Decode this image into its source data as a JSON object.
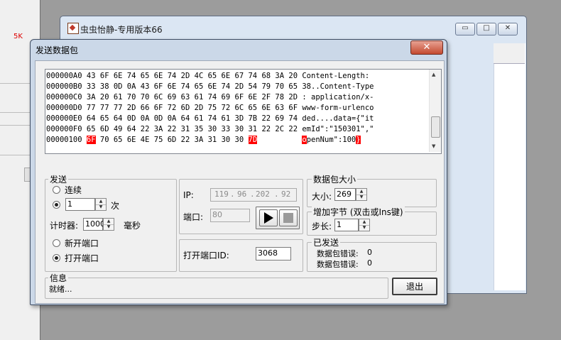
{
  "background_app": {
    "badge": "5K"
  },
  "main_window": {
    "title": "虫虫怡静-专用版本66",
    "minimize": "▭",
    "maximize": "□",
    "close": "✕"
  },
  "dialog": {
    "title": "发送数据包",
    "close": "✕"
  },
  "hex_view": {
    "rows": [
      {
        "addr": "000000A0",
        "bytes": "43 6F 6E 74 65 6E 74 2D 4C 65 6E 67 74 68 3A 20",
        "ascii": "Content-Length: "
      },
      {
        "addr": "000000B0",
        "bytes": "33 38 0D 0A 43 6F 6E 74 65 6E 74 2D 54 79 70 65",
        "ascii": "38..Content-Type"
      },
      {
        "addr": "000000C0",
        "bytes": "3A 20 61 70 70 6C 69 63 61 74 69 6F 6E 2F 78 2D",
        "ascii": ": application/x-"
      },
      {
        "addr": "000000D0",
        "bytes": "77 77 77 2D 66 6F 72 6D 2D 75 72 6C 65 6E 63 6F",
        "ascii": "www-form-urlenco"
      },
      {
        "addr": "000000E0",
        "bytes": "64 65 64 0D 0A 0D 0A 64 61 74 61 3D 7B 22 69 74",
        "ascii": "ded....data={\"it"
      },
      {
        "addr": "000000F0",
        "bytes": "65 6D 49 64 22 3A 22 31 35 30 33 30 31 22 2C 22",
        "ascii": "emId\":\"150301\",\""
      }
    ],
    "last_row": {
      "addr": "00000100",
      "first_byte": "6F",
      "mid_bytes": "70 65 6E 4E 75 6D 22 3A 31 30 30",
      "last_byte": "7D",
      "ascii_first": "o",
      "ascii_mid": "penNum\":100",
      "ascii_last": "}"
    },
    "highlight_color": "#ff0000"
  },
  "send_group": {
    "label": "发送",
    "continuous_label": "连续",
    "count_value": "1",
    "count_unit": "次",
    "timer_label": "计时器:",
    "timer_value": "1000",
    "timer_unit": "毫秒",
    "new_port_label": "新开端口",
    "open_port_label": "打开端口",
    "selected_mode": "count",
    "selected_port": "open"
  },
  "connection": {
    "ip_label": "IP:",
    "ip_parts": [
      "119",
      "96",
      "202",
      "92"
    ],
    "port_label": "端口:",
    "port_value": "80",
    "open_port_id_label": "打开端口ID:",
    "open_port_id_value": "3068"
  },
  "packet_size": {
    "label": "数据包大小",
    "size_label": "大小:",
    "size_value": "269"
  },
  "add_bytes": {
    "label": "增加字节 (双击或Ins键)",
    "step_label": "步长:",
    "step_value": "1"
  },
  "sent": {
    "label": "已发送",
    "errors_label_1": "数据包错误:",
    "errors_value_1": "0",
    "errors_label_2": "数据包错误:",
    "errors_value_2": "0"
  },
  "info": {
    "label": "信息",
    "status": "就绪..."
  },
  "exit_button": "退出"
}
